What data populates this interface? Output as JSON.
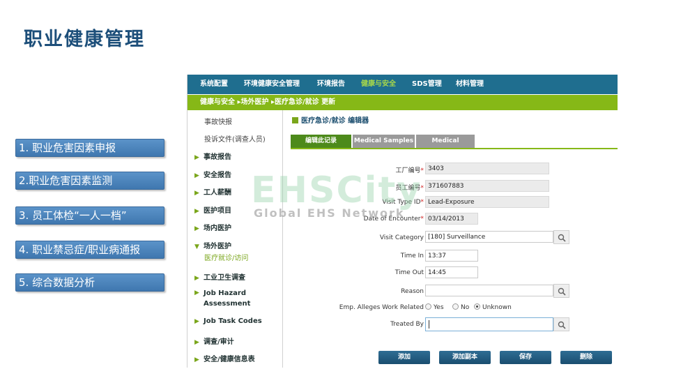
{
  "slide": {
    "title": "职业健康管理",
    "menu": [
      "1. 职业危害因素申报",
      "2.职业危害因素监测",
      "3. 员工体检“一人一档”",
      "4. 职业禁忌症/职业病通报",
      "5. 综合数据分析"
    ]
  },
  "app": {
    "nav": [
      "系统配置",
      "环境健康安全管理",
      "环境报告",
      "健康与安全",
      "SDS管理",
      "材料管理"
    ],
    "nav_active": "健康与安全",
    "breadcrumb": "健康与安全 ▸场外医护 ▸医疗急诊/就诊 更新",
    "sidebar": {
      "links": [
        "事故快报",
        "投诉文件(调查人员)"
      ],
      "sections": [
        "事故报告",
        "安全报告",
        "工人薪酬",
        "医护项目",
        "场内医护",
        "场外医护",
        "工业卫生调查",
        "Job Hazard Assessment",
        "Job Task Codes",
        "调查/审计",
        "安全/健康信息表"
      ],
      "active_sub": "医疗就诊/访问"
    },
    "page_title": "医疗急诊/就诊 编辑器",
    "tabs": [
      "编辑此记录",
      "Medical Samples",
      "Medical Findings"
    ],
    "form": {
      "plant_id": {
        "label": "工厂编号",
        "value": "3403"
      },
      "employee_id": {
        "label": "员工编号",
        "value": "371607883"
      },
      "visit_type": {
        "label": "Visit Type ID",
        "value": "Lead-Exposure"
      },
      "date": {
        "label": "Date of Encounter",
        "value": "03/14/2013"
      },
      "visit_category": {
        "label": "Visit Category",
        "value": "[180] Surveillance"
      },
      "time_in": {
        "label": "Time In",
        "value": "13:37"
      },
      "time_out": {
        "label": "Time Out",
        "value": "14:45"
      },
      "reason": {
        "label": "Reason",
        "value": ""
      },
      "work_related": {
        "label": "Emp. Alleges Work Related",
        "options": [
          "Yes",
          "No",
          "Unknown"
        ],
        "selected": "Unknown"
      },
      "treated_by": {
        "label": "Treated By",
        "value": ""
      }
    },
    "buttons": [
      "添加",
      "添加副本",
      "保存",
      "删除"
    ]
  },
  "watermark": {
    "big": "EHSCity",
    "small": "Global EHS Network"
  },
  "colors": {
    "nav_bg": "#1f6e8f",
    "breadcrumb_bg": "#86b817",
    "menu_btn": "#4a85bd",
    "title": "#1d4f7a"
  }
}
